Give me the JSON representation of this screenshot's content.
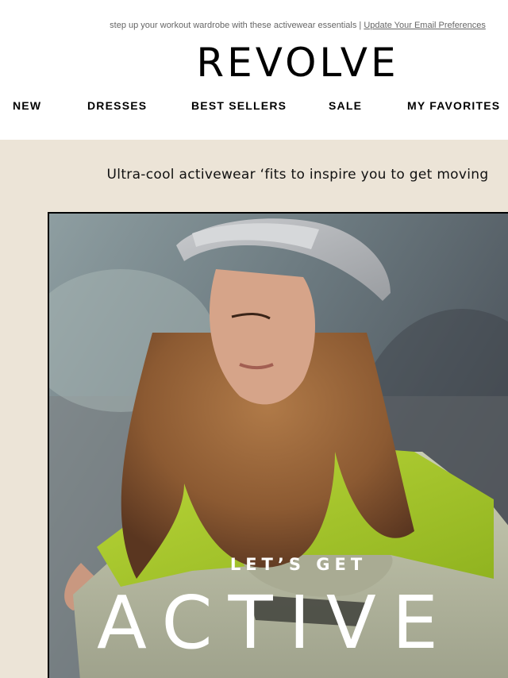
{
  "preheader": {
    "text": "step up your workout wardrobe with these activewear essentials | ",
    "link_label": "Update Your Email Preferences"
  },
  "brand": {
    "logo_text": "REVOLVE"
  },
  "nav": {
    "items": [
      {
        "label": "NEW"
      },
      {
        "label": "DRESSES"
      },
      {
        "label": "BEST SELLERS"
      },
      {
        "label": "SALE"
      },
      {
        "label": "MY FAVORITES"
      }
    ]
  },
  "intro": {
    "tagline": "Ultra-cool activewear ‘fits to inspire you to get moving"
  },
  "hero": {
    "kicker": "LET’S GET",
    "title": "ACTIVE",
    "image_alt_icon": "hero-photo-woman-in-cap-and-lime-pullover"
  },
  "colors": {
    "background": "#ffffff",
    "beige": "#ece4d7",
    "text": "#000000",
    "lime": "#a8cc2a"
  }
}
